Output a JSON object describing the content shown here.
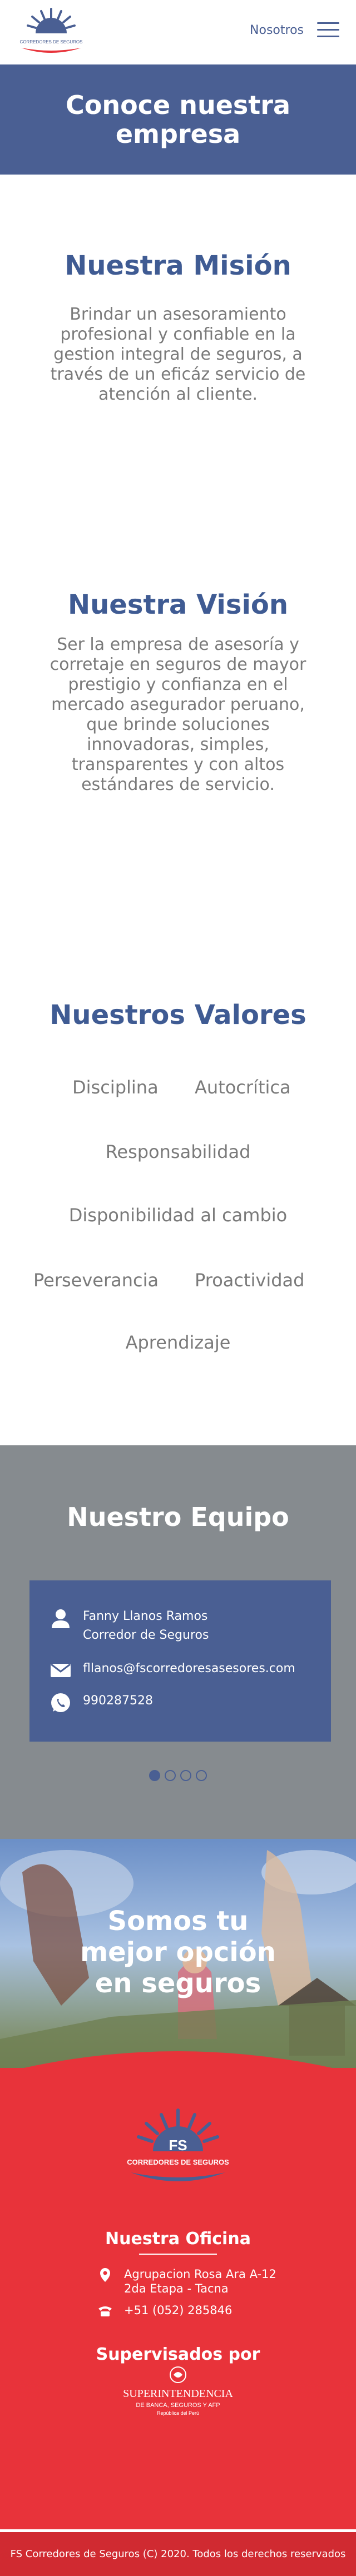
{
  "header": {
    "logo_label": "CORREDORES DE SEGUROS",
    "nav_label": "Nosotros"
  },
  "hero": {
    "title": "Conoce nuestra empresa"
  },
  "mission": {
    "title": "Nuestra Misión",
    "text": "Brindar un asesoramiento profesional y confiable en la gestion integral de seguros, a través de un eficáz servicio de atención al cliente."
  },
  "vision": {
    "title": "Nuestra Visión",
    "text": "Ser la empresa de asesoría y corretaje en seguros de mayor prestigio y confianza en el mercado asegurador peruano, que brinde soluciones innovadoras, simples, transparentes y con altos estándares de servicio."
  },
  "values": {
    "title": "Nuestros Valores",
    "items": [
      "Disciplina",
      "Autocrítica",
      "Responsabilidad",
      "Disponibilidad al cambio",
      "Perseverancia",
      "Proactividad",
      "Aprendizaje"
    ]
  },
  "team": {
    "title": "Nuestro Equipo",
    "member": {
      "name": "Fanny Llanos Ramos",
      "role": "Corredor de Seguros",
      "email": "fllanos@fscorredoresasesores.com",
      "phone": "990287528"
    }
  },
  "banner": {
    "title": "Somos tu mejor opción en seguros"
  },
  "footer": {
    "logo_big": "FS",
    "logo_label": "CORREDORES DE SEGUROS",
    "office_title": "Nuestra Oficina",
    "address_line1": "Agrupacion Rosa Ara A-12",
    "address_line2": "2da Etapa - Tacna",
    "phone": "+51 (052) 285846",
    "supervised_title": "Supervisados por",
    "sbs_name": "SUPERINTENDENCIA",
    "sbs_sub": "DE BANCA, SEGUROS Y AFP",
    "sbs_country": "República del Perú",
    "copyright": "FS Corredores de Seguros (C) 2020. Todos los derechos reservados"
  },
  "colors": {
    "primary": "#4a5f93",
    "red": "#e8333a",
    "gray": "#868b8f"
  }
}
